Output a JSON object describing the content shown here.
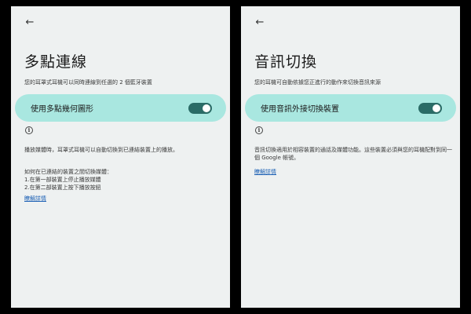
{
  "colors": {
    "toggle_card_bg": "#a9e7e0",
    "switch_track": "#2a6b66",
    "link": "#1a5fb4"
  },
  "left": {
    "back_icon": "arrow-left-icon",
    "title": "多點連線",
    "subtitle": "您的耳罩式耳機可以同時連線到任選的 2 個藍牙裝置",
    "toggle_label": "使用多點幾何圖形",
    "toggle_on": true,
    "info_icon": "info-icon",
    "description": "播放媒體時，耳罩式耳機可以自動切換到已連結裝置上的播放。",
    "howto_title": "如何在已連結的裝置之間切換媒體：",
    "steps": [
      "1.在第一部裝置上停止播放媒體",
      "2.在第二部裝置上按下播放按鈕"
    ],
    "link": "瞭解詳情"
  },
  "right": {
    "back_icon": "arrow-left-icon",
    "title": "音訊切換",
    "subtitle": "您的耳機可自動依據您正進行的動作來切換音訊來源",
    "toggle_label": "使用音訊外接切換裝置",
    "toggle_on": true,
    "info_icon": "info-icon",
    "description": "音訊切換適用於相容裝置的通話及媒體功能。這些裝置必須與您的耳機配對到同一個 Google 帳號。",
    "link": "瞭解詳情"
  }
}
